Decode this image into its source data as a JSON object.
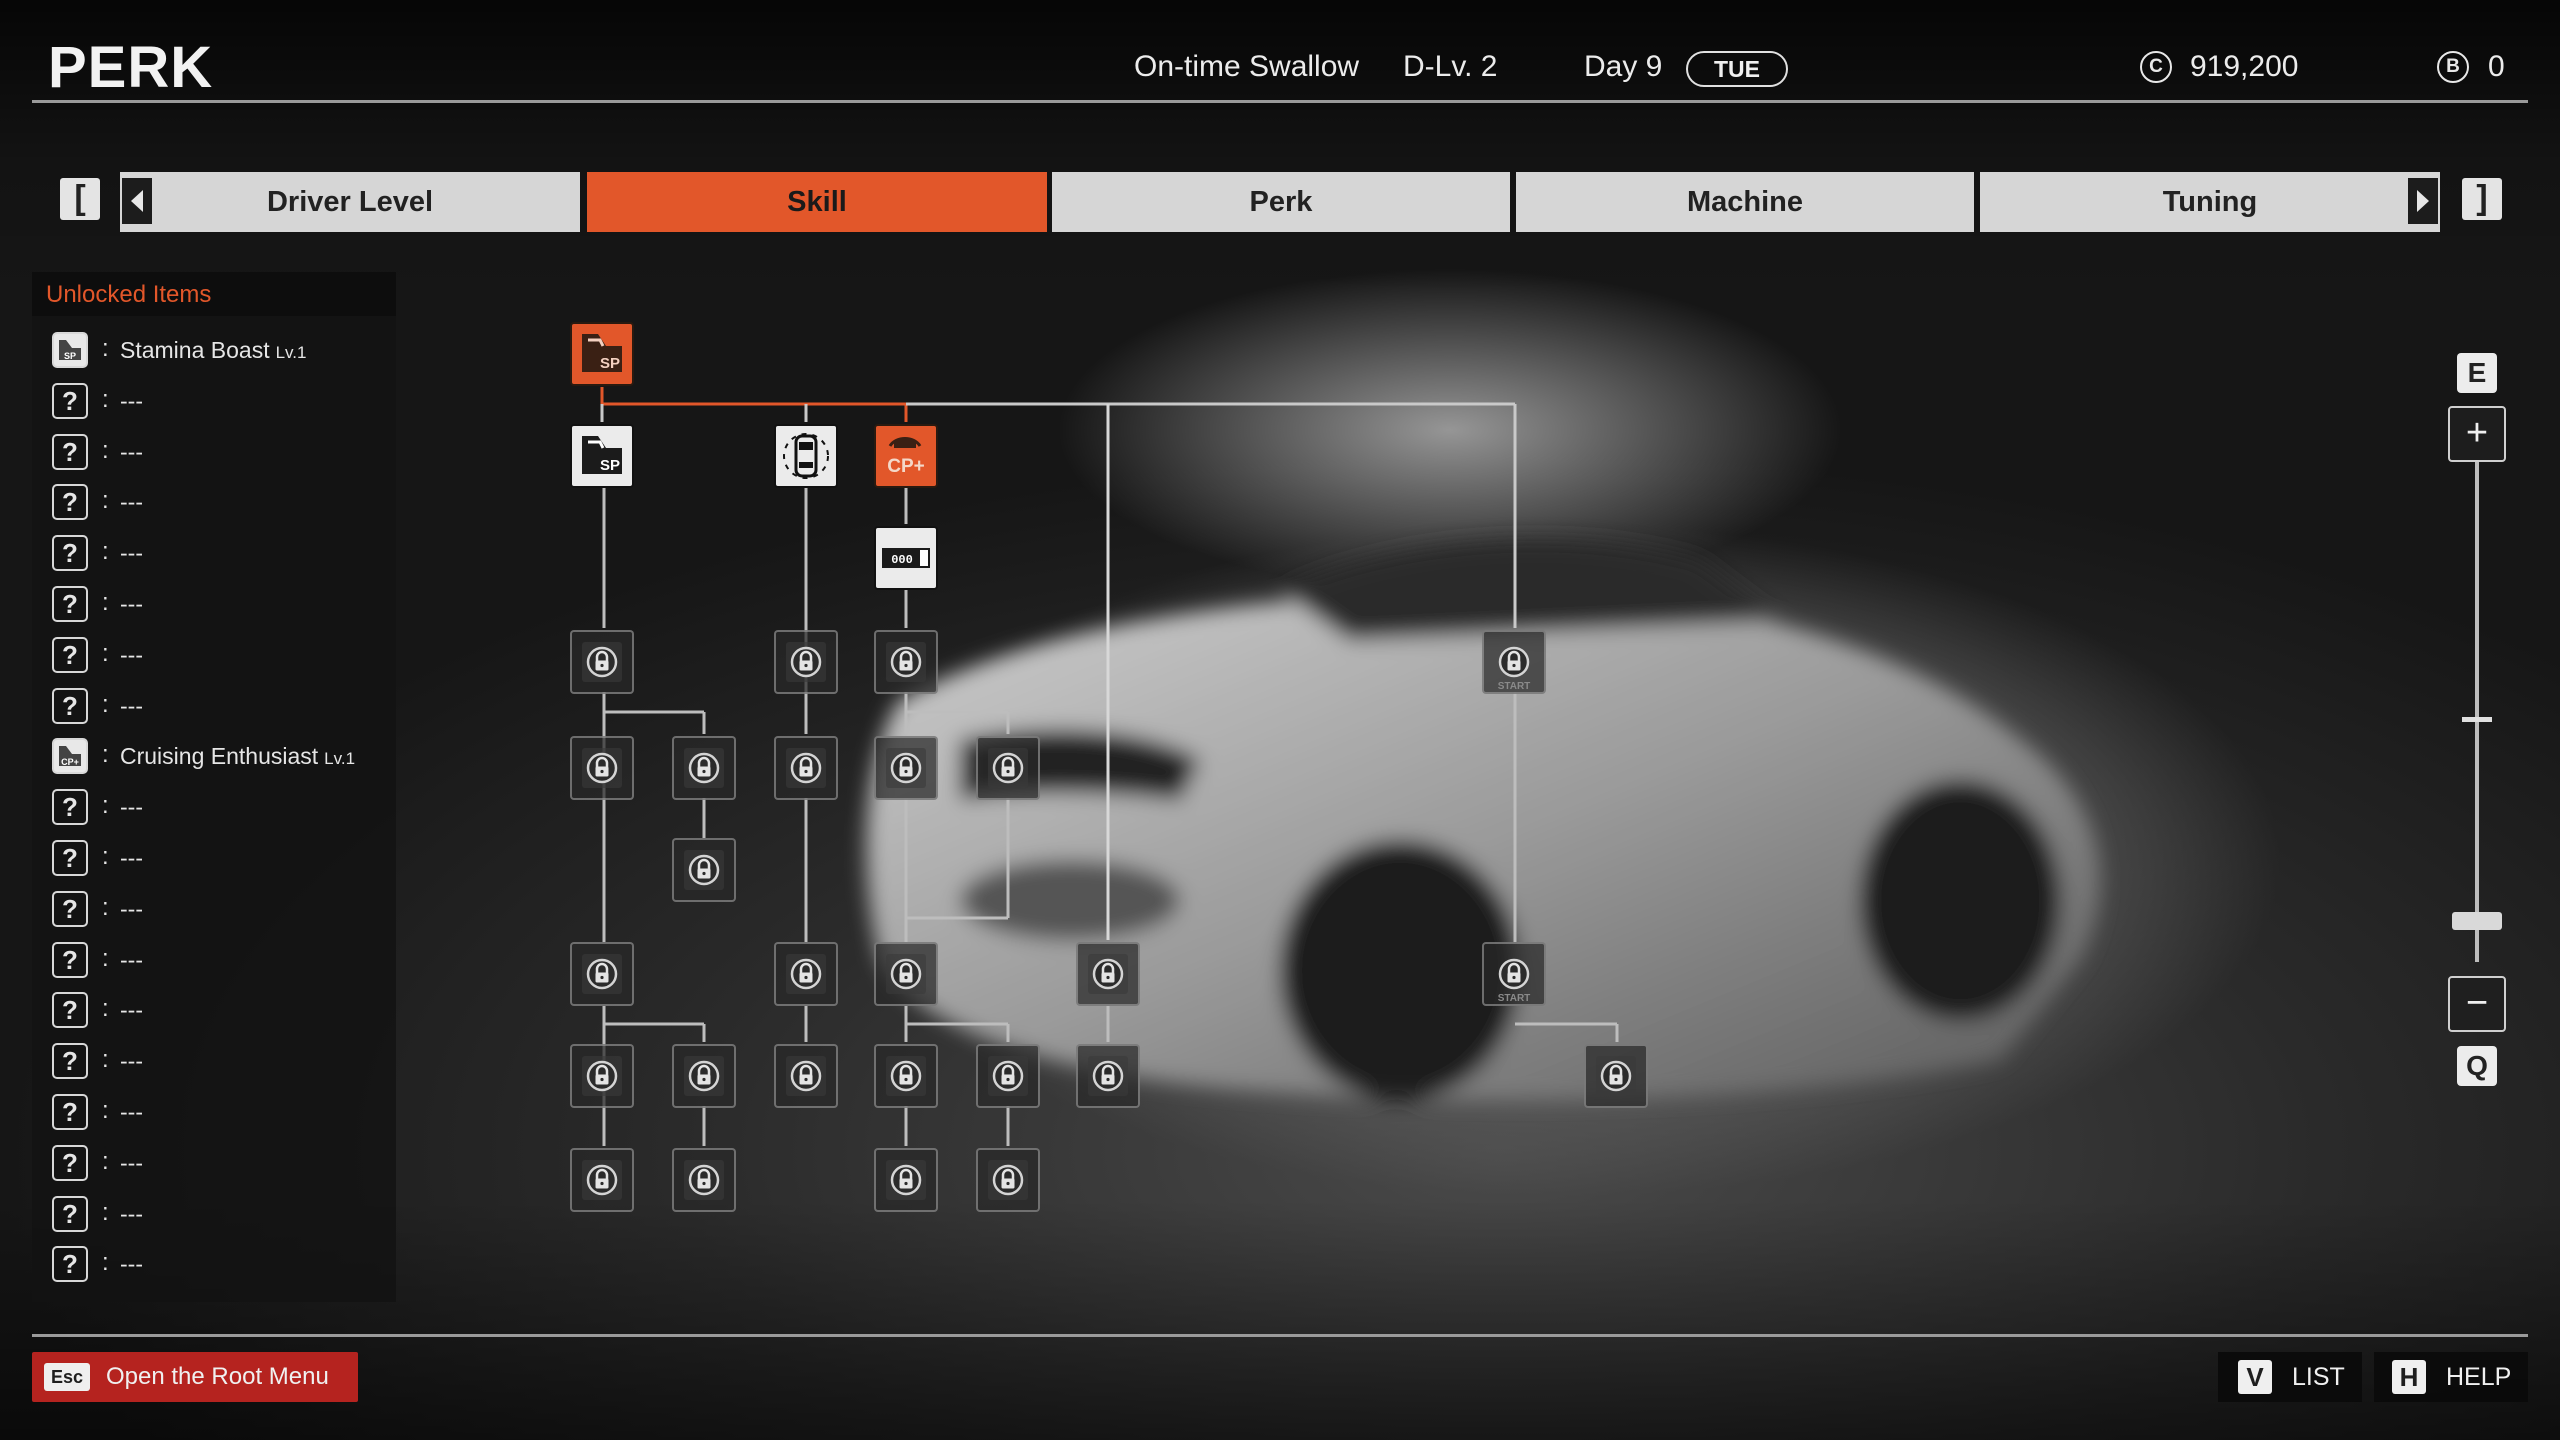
{
  "header": {
    "title": "PERK",
    "driver_name": "On-time Swallow",
    "driver_level": "D-Lv. 2",
    "day": "Day 9",
    "weekday": "TUE",
    "credits_symbol": "C",
    "credits": "919,200",
    "points_symbol": "B",
    "points": "0"
  },
  "tabs": {
    "left_key": "[",
    "right_key": "]",
    "items": [
      "Driver Level",
      "Skill",
      "Perk",
      "Machine",
      "Tuning"
    ],
    "active": "Skill"
  },
  "unlocked_panel": {
    "heading": "Unlocked Items",
    "items": [
      {
        "icon": "stamina-boost-icon",
        "name": "Stamina Boast",
        "level": "Lv.1"
      },
      {
        "icon": "question-icon",
        "name": "---",
        "level": ""
      },
      {
        "icon": "question-icon",
        "name": "---",
        "level": ""
      },
      {
        "icon": "question-icon",
        "name": "---",
        "level": ""
      },
      {
        "icon": "question-icon",
        "name": "---",
        "level": ""
      },
      {
        "icon": "question-icon",
        "name": "---",
        "level": ""
      },
      {
        "icon": "question-icon",
        "name": "---",
        "level": ""
      },
      {
        "icon": "question-icon",
        "name": "---",
        "level": ""
      },
      {
        "icon": "cruising-enthusiast-icon",
        "name": "Cruising Enthusiast",
        "level": "Lv.1"
      },
      {
        "icon": "question-icon",
        "name": "---",
        "level": ""
      },
      {
        "icon": "question-icon",
        "name": "---",
        "level": ""
      },
      {
        "icon": "question-icon",
        "name": "---",
        "level": ""
      },
      {
        "icon": "question-icon",
        "name": "---",
        "level": ""
      },
      {
        "icon": "question-icon",
        "name": "---",
        "level": ""
      },
      {
        "icon": "question-icon",
        "name": "---",
        "level": ""
      },
      {
        "icon": "question-icon",
        "name": "---",
        "level": ""
      },
      {
        "icon": "question-icon",
        "name": "---",
        "level": ""
      },
      {
        "icon": "question-icon",
        "name": "---",
        "level": ""
      },
      {
        "icon": "question-icon",
        "name": "---",
        "level": ""
      }
    ],
    "question_glyph": "?",
    "separator": ":"
  },
  "perk_tree": {
    "node_labels": {
      "sp": "SP",
      "cp": "CP+",
      "start": "START",
      "counter": "000"
    },
    "unlocked_nodes": [
      "sp-root",
      "sp-stamina",
      "car-body",
      "cp-plus",
      "counter"
    ],
    "active_color": "#e2572a"
  },
  "zoom": {
    "zoom_in_key": "E",
    "zoom_in": "+",
    "zoom_out": "−",
    "zoom_out_key": "Q",
    "level": 0.08
  },
  "footer": {
    "root_menu_key": "Esc",
    "root_menu_label": "Open the Root Menu",
    "list_key": "V",
    "list_label": "LIST",
    "help_key": "H",
    "help_label": "HELP"
  },
  "colors": {
    "accent": "#e2572a",
    "footer_button": "#b5231f"
  }
}
